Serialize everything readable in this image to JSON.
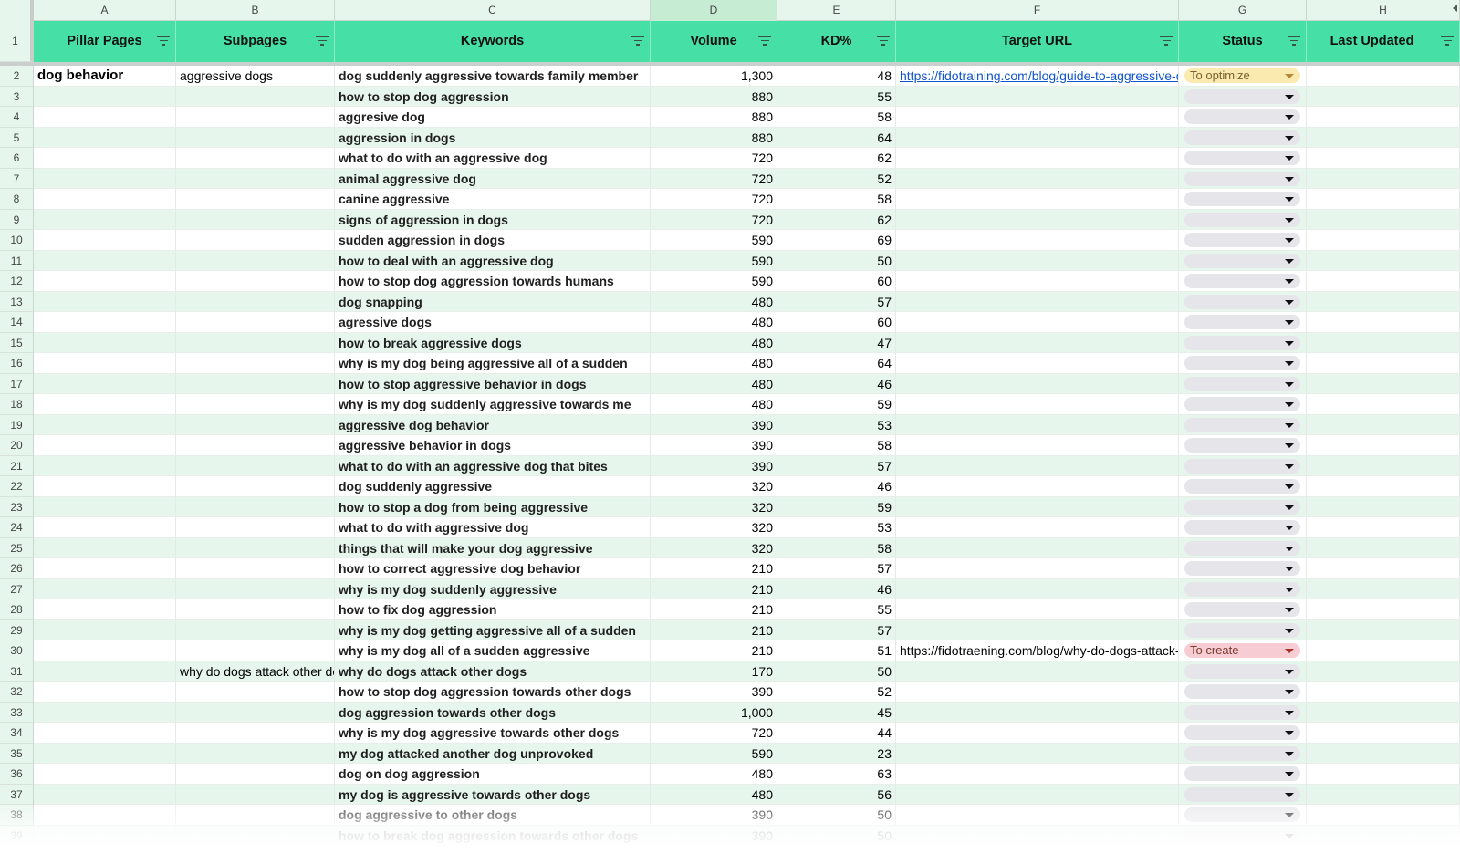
{
  "column_letters": [
    "A",
    "B",
    "C",
    "D",
    "E",
    "F",
    "G",
    "H"
  ],
  "selected_column": "D",
  "header_row": {
    "row_number": "1",
    "pillar_pages": "Pillar Pages",
    "subpages": "Subpages",
    "keywords": "Keywords",
    "volume": "Volume",
    "kd": "KD%",
    "target_url": "Target URL",
    "status": "Status",
    "last_updated": "Last Updated"
  },
  "colors": {
    "header_bg": "#46e0a6",
    "band_bg": "#e6f6ec",
    "link": "#1155cc",
    "status_to_optimize": "#fbeab0",
    "status_to_create": "#f7cdd3",
    "status_empty": "#e6e6ea"
  },
  "rows": [
    {
      "n": "2",
      "pillar": "dog behavior",
      "sub": "aggressive dogs",
      "kw": "dog suddenly aggressive towards family member",
      "vol": "1,300",
      "kd": "48",
      "url": "https://fidotraining.com/blog/guide-to-aggressive-dogs",
      "url_link": true,
      "status": "To optimize"
    },
    {
      "n": "3",
      "pillar": "",
      "sub": "",
      "kw": "how to stop dog aggression",
      "vol": "880",
      "kd": "55",
      "url": "",
      "status": ""
    },
    {
      "n": "4",
      "pillar": "",
      "sub": "",
      "kw": "aggresive dog",
      "vol": "880",
      "kd": "58",
      "url": "",
      "status": ""
    },
    {
      "n": "5",
      "pillar": "",
      "sub": "",
      "kw": "aggression in dogs",
      "vol": "880",
      "kd": "64",
      "url": "",
      "status": ""
    },
    {
      "n": "6",
      "pillar": "",
      "sub": "",
      "kw": "what to do with an aggressive dog",
      "vol": "720",
      "kd": "62",
      "url": "",
      "status": ""
    },
    {
      "n": "7",
      "pillar": "",
      "sub": "",
      "kw": "animal aggressive dog",
      "vol": "720",
      "kd": "52",
      "url": "",
      "status": ""
    },
    {
      "n": "8",
      "pillar": "",
      "sub": "",
      "kw": "canine aggressive",
      "vol": "720",
      "kd": "58",
      "url": "",
      "status": ""
    },
    {
      "n": "9",
      "pillar": "",
      "sub": "",
      "kw": "signs of aggression in dogs",
      "vol": "720",
      "kd": "62",
      "url": "",
      "status": ""
    },
    {
      "n": "10",
      "pillar": "",
      "sub": "",
      "kw": "sudden aggression in dogs",
      "vol": "590",
      "kd": "69",
      "url": "",
      "status": ""
    },
    {
      "n": "11",
      "pillar": "",
      "sub": "",
      "kw": "how to deal with an aggressive dog",
      "vol": "590",
      "kd": "50",
      "url": "",
      "status": ""
    },
    {
      "n": "12",
      "pillar": "",
      "sub": "",
      "kw": "how to stop dog aggression towards humans",
      "vol": "590",
      "kd": "60",
      "url": "",
      "status": ""
    },
    {
      "n": "13",
      "pillar": "",
      "sub": "",
      "kw": "dog snapping",
      "vol": "480",
      "kd": "57",
      "url": "",
      "status": ""
    },
    {
      "n": "14",
      "pillar": "",
      "sub": "",
      "kw": "agressive dogs",
      "vol": "480",
      "kd": "60",
      "url": "",
      "status": ""
    },
    {
      "n": "15",
      "pillar": "",
      "sub": "",
      "kw": "how to break aggressive dogs",
      "vol": "480",
      "kd": "47",
      "url": "",
      "status": ""
    },
    {
      "n": "16",
      "pillar": "",
      "sub": "",
      "kw": "why is my dog being aggressive all of a sudden",
      "vol": "480",
      "kd": "64",
      "url": "",
      "status": ""
    },
    {
      "n": "17",
      "pillar": "",
      "sub": "",
      "kw": "how to stop aggressive behavior in dogs",
      "vol": "480",
      "kd": "46",
      "url": "",
      "status": ""
    },
    {
      "n": "18",
      "pillar": "",
      "sub": "",
      "kw": "why is my dog suddenly aggressive towards me",
      "vol": "480",
      "kd": "59",
      "url": "",
      "status": ""
    },
    {
      "n": "19",
      "pillar": "",
      "sub": "",
      "kw": "aggressive dog behavior",
      "vol": "390",
      "kd": "53",
      "url": "",
      "status": ""
    },
    {
      "n": "20",
      "pillar": "",
      "sub": "",
      "kw": "aggressive behavior in dogs",
      "vol": "390",
      "kd": "58",
      "url": "",
      "status": ""
    },
    {
      "n": "21",
      "pillar": "",
      "sub": "",
      "kw": "what to do with an aggressive dog that bites",
      "vol": "390",
      "kd": "57",
      "url": "",
      "status": ""
    },
    {
      "n": "22",
      "pillar": "",
      "sub": "",
      "kw": "dog suddenly aggressive",
      "vol": "320",
      "kd": "46",
      "url": "",
      "status": ""
    },
    {
      "n": "23",
      "pillar": "",
      "sub": "",
      "kw": "how to stop a dog from being aggressive",
      "vol": "320",
      "kd": "59",
      "url": "",
      "status": ""
    },
    {
      "n": "24",
      "pillar": "",
      "sub": "",
      "kw": "what to do with aggressive dog",
      "vol": "320",
      "kd": "53",
      "url": "",
      "status": ""
    },
    {
      "n": "25",
      "pillar": "",
      "sub": "",
      "kw": "things that will make your dog aggressive",
      "vol": "320",
      "kd": "58",
      "url": "",
      "status": ""
    },
    {
      "n": "26",
      "pillar": "",
      "sub": "",
      "kw": "how to correct aggressive dog behavior",
      "vol": "210",
      "kd": "57",
      "url": "",
      "status": ""
    },
    {
      "n": "27",
      "pillar": "",
      "sub": "",
      "kw": "why is my dog suddenly aggressive",
      "vol": "210",
      "kd": "46",
      "url": "",
      "status": ""
    },
    {
      "n": "28",
      "pillar": "",
      "sub": "",
      "kw": "how to fix dog aggression",
      "vol": "210",
      "kd": "55",
      "url": "",
      "status": ""
    },
    {
      "n": "29",
      "pillar": "",
      "sub": "",
      "kw": "why is my dog getting aggressive all of a sudden",
      "vol": "210",
      "kd": "57",
      "url": "",
      "status": ""
    },
    {
      "n": "30",
      "pillar": "",
      "sub": "",
      "kw": "why is my dog all of a sudden aggressive",
      "vol": "210",
      "kd": "51",
      "url": "https://fidotraening.com/blog/why-do-dogs-attack-other-dogs",
      "url_link": false,
      "status": "To create"
    },
    {
      "n": "31",
      "pillar": "",
      "sub": "why do dogs attack other dogs",
      "kw": "why do dogs attack other dogs",
      "vol": "170",
      "kd": "50",
      "url": "",
      "status": ""
    },
    {
      "n": "32",
      "pillar": "",
      "sub": "",
      "kw": "how to stop dog aggression towards other dogs",
      "vol": "390",
      "kd": "52",
      "url": "",
      "status": ""
    },
    {
      "n": "33",
      "pillar": "",
      "sub": "",
      "kw": "dog aggression towards other dogs",
      "vol": "1,000",
      "kd": "45",
      "url": "",
      "status": ""
    },
    {
      "n": "34",
      "pillar": "",
      "sub": "",
      "kw": "why is my dog aggressive towards other dogs",
      "vol": "720",
      "kd": "44",
      "url": "",
      "status": ""
    },
    {
      "n": "35",
      "pillar": "",
      "sub": "",
      "kw": "my dog attacked another dog unprovoked",
      "vol": "590",
      "kd": "23",
      "url": "",
      "status": ""
    },
    {
      "n": "36",
      "pillar": "",
      "sub": "",
      "kw": "dog on dog aggression",
      "vol": "480",
      "kd": "63",
      "url": "",
      "status": ""
    },
    {
      "n": "37",
      "pillar": "",
      "sub": "",
      "kw": "my dog is aggressive towards other dogs",
      "vol": "480",
      "kd": "56",
      "url": "",
      "status": ""
    },
    {
      "n": "38",
      "pillar": "",
      "sub": "",
      "kw": "dog aggressive to other dogs",
      "vol": "390",
      "kd": "50",
      "url": "",
      "status": ""
    },
    {
      "n": "39",
      "pillar": "",
      "sub": "",
      "kw": "how to break dog aggression towards other dogs",
      "vol": "390",
      "kd": "50",
      "url": "",
      "status": ""
    }
  ]
}
